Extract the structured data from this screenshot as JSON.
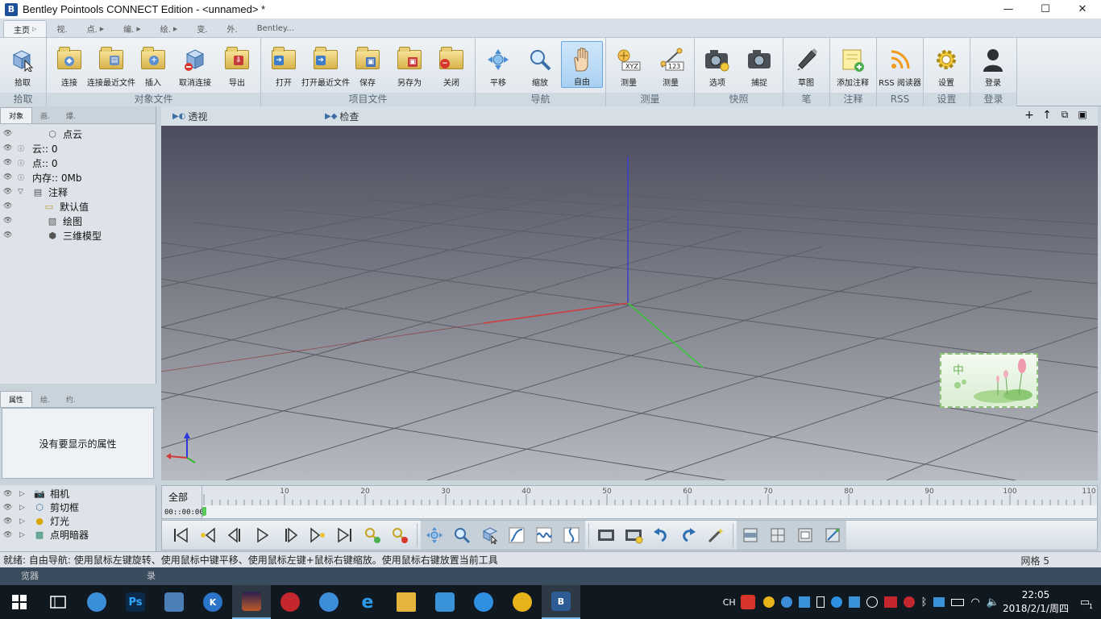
{
  "window": {
    "title": "Bentley Pointools CONNECT Edition  -  <unnamed> *",
    "minimize": "—",
    "maximize": "☐",
    "close": "✕"
  },
  "ribbon_tabs": [
    "主页",
    "视.",
    "点.",
    "编.",
    "绘.",
    "变.",
    "外.",
    "Bentley..."
  ],
  "ribbon": {
    "groups": [
      {
        "label": "拾取",
        "buttons": [
          {
            "label": "拾取",
            "icon": "pick-cube-icon"
          }
        ]
      },
      {
        "label": "对象文件",
        "buttons": [
          {
            "label": "连接",
            "icon": "folder-cube-icon"
          },
          {
            "label": "连接最近文件",
            "icon": "folder-recent-icon"
          },
          {
            "label": "插入",
            "icon": "folder-insert-icon"
          },
          {
            "label": "取消连接",
            "icon": "disconnect-icon"
          },
          {
            "label": "导出",
            "icon": "folder-export-icon"
          }
        ]
      },
      {
        "label": "项目文件",
        "buttons": [
          {
            "label": "打开",
            "icon": "folder-open-icon"
          },
          {
            "label": "打开最近文件",
            "icon": "folder-open-recent-icon"
          },
          {
            "label": "保存",
            "icon": "folder-save-icon"
          },
          {
            "label": "另存为",
            "icon": "folder-saveas-icon"
          },
          {
            "label": "关闭",
            "icon": "folder-close-icon"
          }
        ]
      },
      {
        "label": "导航",
        "buttons": [
          {
            "label": "平移",
            "icon": "pan-icon"
          },
          {
            "label": "缩放",
            "icon": "zoom-icon"
          },
          {
            "label": "自由",
            "icon": "hand-icon",
            "selected": true
          }
        ]
      },
      {
        "label": "测量",
        "buttons": [
          {
            "label": "测量",
            "icon": "measure-xyz-icon"
          },
          {
            "label": "测量",
            "icon": "measure-distance-icon"
          }
        ]
      },
      {
        "label": "快照",
        "buttons": [
          {
            "label": "选项",
            "icon": "camera-options-icon"
          },
          {
            "label": "捕捉",
            "icon": "camera-icon"
          }
        ]
      },
      {
        "label": "笔",
        "buttons": [
          {
            "label": "草图",
            "icon": "pen-icon"
          }
        ]
      },
      {
        "label": "注释",
        "buttons": [
          {
            "label": "添加注释",
            "icon": "add-note-icon"
          }
        ]
      },
      {
        "label": "RSS",
        "buttons": [
          {
            "label": "RSS 阅读器",
            "icon": "rss-icon"
          }
        ]
      },
      {
        "label": "设置",
        "buttons": [
          {
            "label": "设置",
            "icon": "gear-icon"
          }
        ]
      },
      {
        "label": "登录",
        "buttons": [
          {
            "label": "登录",
            "icon": "user-icon"
          }
        ]
      }
    ]
  },
  "left_panel": {
    "tabs": [
      "对象",
      "画.",
      "爆."
    ],
    "tree": [
      {
        "label": "点云",
        "icon": "pointcloud-icon",
        "info": false,
        "expand": ""
      },
      {
        "label": "云:: 0",
        "icon": "",
        "info": true,
        "expand": ""
      },
      {
        "label": "点:: 0",
        "icon": "",
        "info": true,
        "expand": ""
      },
      {
        "label": "内存:: 0Mb",
        "icon": "",
        "info": true,
        "expand": ""
      },
      {
        "label": "注释",
        "icon": "notes-icon",
        "info": false,
        "expand": "▽"
      },
      {
        "label": "默认值",
        "icon": "folder-icon",
        "info": false,
        "expand": "",
        "indent": true
      },
      {
        "label": "绘图",
        "icon": "drawing-icon",
        "info": false,
        "expand": ""
      },
      {
        "label": "三维模型",
        "icon": "model-icon",
        "info": false,
        "expand": ""
      }
    ]
  },
  "properties": {
    "tabs": [
      "属性",
      "绘.",
      "约."
    ],
    "empty_text": "没有要显示的属性"
  },
  "viewport": {
    "views": [
      "透视",
      "检查"
    ],
    "head_icons": [
      "add-icon",
      "up-arrow-icon",
      "maximize-view-icon",
      "restore-view-icon"
    ]
  },
  "bottom_list": [
    {
      "label": "相机",
      "icon": "camera-small-icon"
    },
    {
      "label": "剪切框",
      "icon": "clipbox-icon"
    },
    {
      "label": "灯光",
      "icon": "light-icon"
    },
    {
      "label": "点明暗器",
      "icon": "shader-icon"
    }
  ],
  "timeline": {
    "label_all": "全部",
    "time": "00::00:00",
    "ticks": [
      "10",
      "20",
      "30",
      "40",
      "50",
      "60",
      "70",
      "80",
      "90",
      "100",
      "110"
    ]
  },
  "toolbar": {
    "buttons": [
      "first-frame-icon",
      "prev-key-icon",
      "prev-frame-icon",
      "play-icon",
      "next-frame-icon",
      "next-key-icon",
      "last-frame-icon",
      "add-key-icon",
      "remove-key-icon",
      "pan-tool-icon",
      "zoom-tool-icon",
      "select-tool-icon",
      "curve-tool-icon",
      "wave-tool-icon",
      "vertical-curve-icon",
      "film-icon",
      "film-settings-icon",
      "undo-icon",
      "redo-icon",
      "magic-wand-icon",
      "panel-a-icon",
      "panel-b-icon",
      "panel-c-icon",
      "panel-d-icon"
    ]
  },
  "status": {
    "message": "就绪: 自由导航: 使用鼠标左键旋转、使用鼠标中键平移、使用鼠标左键+鼠标右键缩放。使用鼠标右键放置当前工具",
    "grid": "网格 5"
  },
  "below_strip": {
    "left": "览器",
    "mid": "录"
  },
  "taskbar": {
    "apps": [
      {
        "name": "task-view-icon",
        "color": "#101820"
      },
      {
        "name": "browser-swirl-icon",
        "color": "#3b8fd8"
      },
      {
        "name": "photoshop-icon",
        "color": "#0b2a4a"
      },
      {
        "name": "computer-icon",
        "color": "#4c7fb7"
      },
      {
        "name": "k-app-icon",
        "color": "#2a74c9"
      },
      {
        "name": "image-viewer-icon",
        "color": "#b0472a",
        "active": true
      },
      {
        "name": "red-app-icon",
        "color": "#c4272d"
      },
      {
        "name": "bird-app-icon",
        "color": "#3c8edb"
      },
      {
        "name": "ie-icon",
        "color": "#2b7ed8"
      },
      {
        "name": "file-explorer-icon",
        "color": "#e5b53f"
      },
      {
        "name": "network-app-icon",
        "color": "#3a93d9"
      },
      {
        "name": "sogou-icon",
        "color": "#2f8fe0"
      },
      {
        "name": "chrome-like-icon",
        "color": "#e8b21b"
      },
      {
        "name": "bentley-icon",
        "color": "#2d5b94",
        "active": true
      }
    ],
    "lang": "CH",
    "time": "22:05",
    "date": "2018/2/1/周四",
    "notif": "1"
  }
}
